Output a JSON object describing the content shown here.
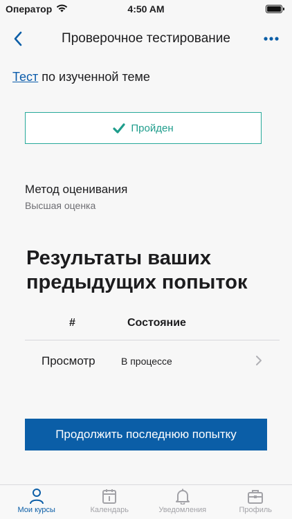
{
  "status_bar": {
    "carrier": "Оператор",
    "time": "4:50 AM"
  },
  "nav": {
    "title": "Проверочное тестирование"
  },
  "intro": {
    "link_text": "Тест",
    "rest_text": " по изученной теме"
  },
  "result_status": {
    "label": "Пройден",
    "color": "#27a99a"
  },
  "grading": {
    "label": "Метод оценивания",
    "value": "Высшая оценка"
  },
  "attempts": {
    "title": "Результаты ваших предыдущих попыток",
    "columns": [
      "#",
      "Состояние"
    ],
    "rows": [
      {
        "view": "Просмотр",
        "state": "В процессе"
      }
    ]
  },
  "continue_button": {
    "label": "Продолжить последнюю попытку",
    "color": "#0b5ea7"
  },
  "tab_bar": {
    "tabs": [
      {
        "label": "Мои курсы",
        "icon": "person-icon",
        "active": true
      },
      {
        "label": "Календарь",
        "icon": "calendar-icon",
        "active": false
      },
      {
        "label": "Уведомления",
        "icon": "bell-icon",
        "active": false
      },
      {
        "label": "Профиль",
        "icon": "briefcase-icon",
        "active": false
      }
    ]
  }
}
